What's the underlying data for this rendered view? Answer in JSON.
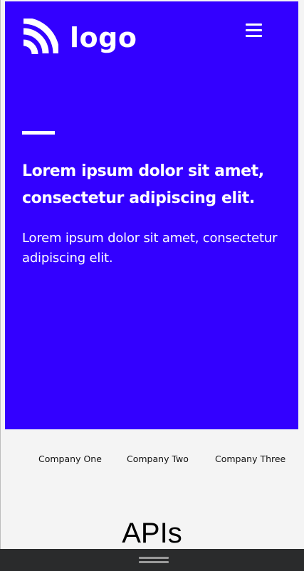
{
  "header": {
    "logo_text": "logo",
    "logo_icon": "wifi-arcs-icon",
    "menu_icon": "hamburger-menu-icon"
  },
  "hero": {
    "heading": "Lorem ipsum dolor sit amet, consectetur adipiscing elit.",
    "text": "Lorem ipsum dolor sit amet, consectetur adipiscing elit."
  },
  "companies": [
    "Company One",
    "Company Two",
    "Company Three"
  ],
  "section": {
    "title": "APIs"
  },
  "colors": {
    "hero_background": "#3300ff",
    "page_background": "#f4f4f4",
    "bottom_bar": "#2a2b2c"
  }
}
